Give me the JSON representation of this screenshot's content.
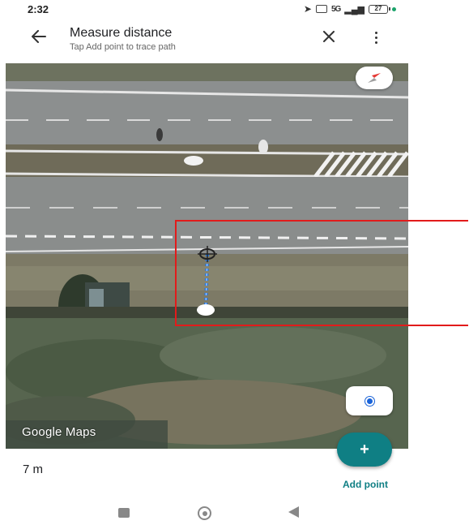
{
  "status_bar": {
    "time": "2:32",
    "network_label": "5G",
    "battery_level": "27"
  },
  "header": {
    "title": "Measure distance",
    "subtitle": "Tap Add point to trace path",
    "back_icon": "arrow-back-icon",
    "close_icon": "close-icon",
    "more_icon": "more-vert-icon"
  },
  "map": {
    "logo_text": "Google Maps",
    "compass_icon": "compass-icon",
    "location_icon": "my-location-icon",
    "crosshair_icon": "crosshair-icon"
  },
  "measurement": {
    "distance": "7 m"
  },
  "actions": {
    "add_point_symbol": "+",
    "add_point_label": "Add point"
  },
  "nav_bar": {
    "recent_icon": "recent-apps-icon",
    "home_icon": "home-icon",
    "back_icon": "nav-back-icon"
  },
  "colors": {
    "accent": "#0f7f84",
    "annotation": "#e21b1b",
    "measure_line": "#1a73e8"
  }
}
